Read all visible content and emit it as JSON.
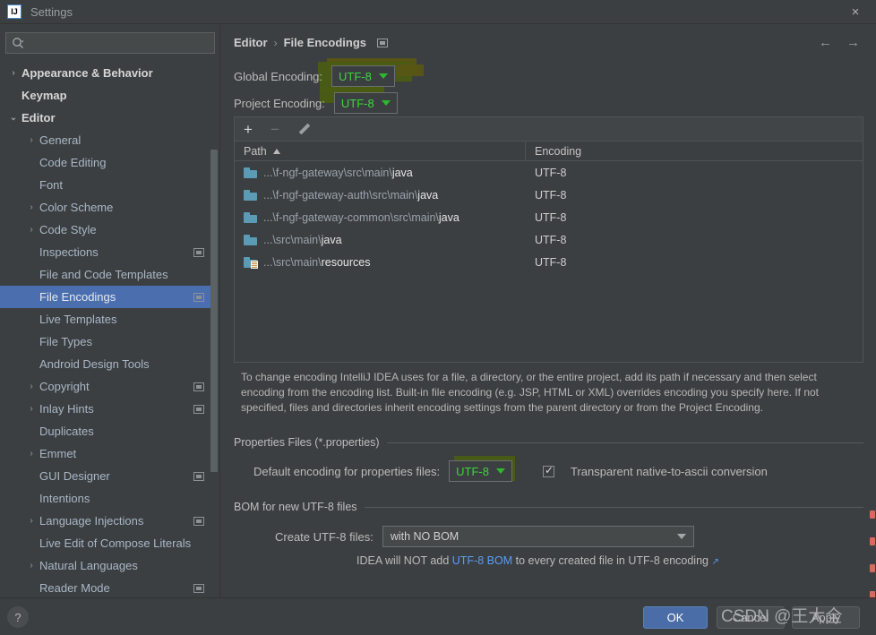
{
  "window": {
    "title": "Settings",
    "app_icon": "IJ",
    "close_icon": "×"
  },
  "sidebar": {
    "search": {
      "placeholder": "",
      "value": "",
      "icon": "search-icon"
    },
    "items": [
      {
        "label": "Appearance & Behavior",
        "arrow": "›",
        "indent": 0,
        "top": true,
        "badge": false,
        "selected": false
      },
      {
        "label": "Keymap",
        "arrow": "",
        "indent": 0,
        "top": true,
        "badge": false,
        "selected": false
      },
      {
        "label": "Editor",
        "arrow": "⌄",
        "indent": 0,
        "top": true,
        "badge": false,
        "selected": false
      },
      {
        "label": "General",
        "arrow": "›",
        "indent": 1,
        "top": false,
        "badge": false,
        "selected": false
      },
      {
        "label": "Code Editing",
        "arrow": "",
        "indent": 1,
        "top": false,
        "badge": false,
        "selected": false
      },
      {
        "label": "Font",
        "arrow": "",
        "indent": 1,
        "top": false,
        "badge": false,
        "selected": false
      },
      {
        "label": "Color Scheme",
        "arrow": "›",
        "indent": 1,
        "top": false,
        "badge": false,
        "selected": false
      },
      {
        "label": "Code Style",
        "arrow": "›",
        "indent": 1,
        "top": false,
        "badge": false,
        "selected": false
      },
      {
        "label": "Inspections",
        "arrow": "",
        "indent": 1,
        "top": false,
        "badge": true,
        "selected": false
      },
      {
        "label": "File and Code Templates",
        "arrow": "",
        "indent": 1,
        "top": false,
        "badge": false,
        "selected": false
      },
      {
        "label": "File Encodings",
        "arrow": "",
        "indent": 1,
        "top": false,
        "badge": true,
        "selected": true
      },
      {
        "label": "Live Templates",
        "arrow": "",
        "indent": 1,
        "top": false,
        "badge": false,
        "selected": false
      },
      {
        "label": "File Types",
        "arrow": "",
        "indent": 1,
        "top": false,
        "badge": false,
        "selected": false
      },
      {
        "label": "Android Design Tools",
        "arrow": "",
        "indent": 1,
        "top": false,
        "badge": false,
        "selected": false
      },
      {
        "label": "Copyright",
        "arrow": "›",
        "indent": 1,
        "top": false,
        "badge": true,
        "selected": false
      },
      {
        "label": "Inlay Hints",
        "arrow": "›",
        "indent": 1,
        "top": false,
        "badge": true,
        "selected": false
      },
      {
        "label": "Duplicates",
        "arrow": "",
        "indent": 1,
        "top": false,
        "badge": false,
        "selected": false
      },
      {
        "label": "Emmet",
        "arrow": "›",
        "indent": 1,
        "top": false,
        "badge": false,
        "selected": false
      },
      {
        "label": "GUI Designer",
        "arrow": "",
        "indent": 1,
        "top": false,
        "badge": true,
        "selected": false
      },
      {
        "label": "Intentions",
        "arrow": "",
        "indent": 1,
        "top": false,
        "badge": false,
        "selected": false
      },
      {
        "label": "Language Injections",
        "arrow": "›",
        "indent": 1,
        "top": false,
        "badge": true,
        "selected": false
      },
      {
        "label": "Live Edit of Compose Literals",
        "arrow": "",
        "indent": 1,
        "top": false,
        "badge": false,
        "selected": false
      },
      {
        "label": "Natural Languages",
        "arrow": "›",
        "indent": 1,
        "top": false,
        "badge": false,
        "selected": false
      },
      {
        "label": "Reader Mode",
        "arrow": "",
        "indent": 1,
        "top": false,
        "badge": true,
        "selected": false
      }
    ]
  },
  "main": {
    "breadcrumb": {
      "parent": "Editor",
      "separator": "›",
      "current": "File Encodings",
      "badge_icon": "module-badge-icon"
    },
    "nav": {
      "back_icon": "←",
      "forward_icon": "→"
    },
    "global_encoding": {
      "label": "Global Encoding:",
      "value": "UTF-8"
    },
    "project_encoding": {
      "label": "Project Encoding:",
      "value": "UTF-8"
    },
    "table_toolbar": {
      "add_icon": "+",
      "remove_icon": "−",
      "edit_icon": "pencil-icon"
    },
    "table": {
      "columns": [
        "Path",
        "Encoding"
      ],
      "sort_column": "Path",
      "sort_direction": "asc",
      "rows": [
        {
          "prefix": "...\\f-ngf-gateway\\src\\main\\",
          "leaf": "java",
          "encoding": "UTF-8",
          "icon": "folder-icon"
        },
        {
          "prefix": "...\\f-ngf-gateway-auth\\src\\main\\",
          "leaf": "java",
          "encoding": "UTF-8",
          "icon": "folder-icon"
        },
        {
          "prefix": "...\\f-ngf-gateway-common\\src\\main\\",
          "leaf": "java",
          "encoding": "UTF-8",
          "icon": "folder-icon"
        },
        {
          "prefix": "...\\src\\main\\",
          "leaf": "java",
          "encoding": "UTF-8",
          "icon": "folder-icon"
        },
        {
          "prefix": "...\\src\\main\\",
          "leaf": "resources",
          "encoding": "UTF-8",
          "icon": "resources-folder-icon"
        }
      ]
    },
    "help_text": "To change encoding IntelliJ IDEA uses for a file, a directory, or the entire project, add its path if necessary and then select encoding from the encoding list. Built-in file encoding (e.g. JSP, HTML or XML) overrides encoding you specify here. If not specified, files and directories inherit encoding settings from the parent directory or from the Project Encoding.",
    "properties_section": {
      "title": "Properties Files (*.properties)",
      "default_encoding_label": "Default encoding for properties files:",
      "default_encoding_value": "UTF-8",
      "checkbox_label": "Transparent native-to-ascii conversion",
      "checkbox_checked": true
    },
    "bom_section": {
      "title": "BOM for new UTF-8 files",
      "create_label": "Create UTF-8 files:",
      "create_value": "with NO BOM",
      "note_before": "IDEA will NOT add ",
      "note_link": "UTF-8 BOM",
      "note_after": " to every created file in UTF-8 encoding",
      "external_icon": "↗"
    }
  },
  "bottom": {
    "help_label": "?",
    "ok_label": "OK",
    "cancel_label": "Cancel",
    "apply_label": "Apply"
  },
  "watermark": {
    "text": "CSDN @王大全"
  },
  "colors": {
    "background": "#3c3f41",
    "selection": "#4b6eaf",
    "accent_green": "#3fd33f",
    "marker_green": "#4a5c12",
    "link_blue": "#589df6",
    "primary_button": "#4a6da7",
    "folder_blue": "#5b9bb5"
  }
}
